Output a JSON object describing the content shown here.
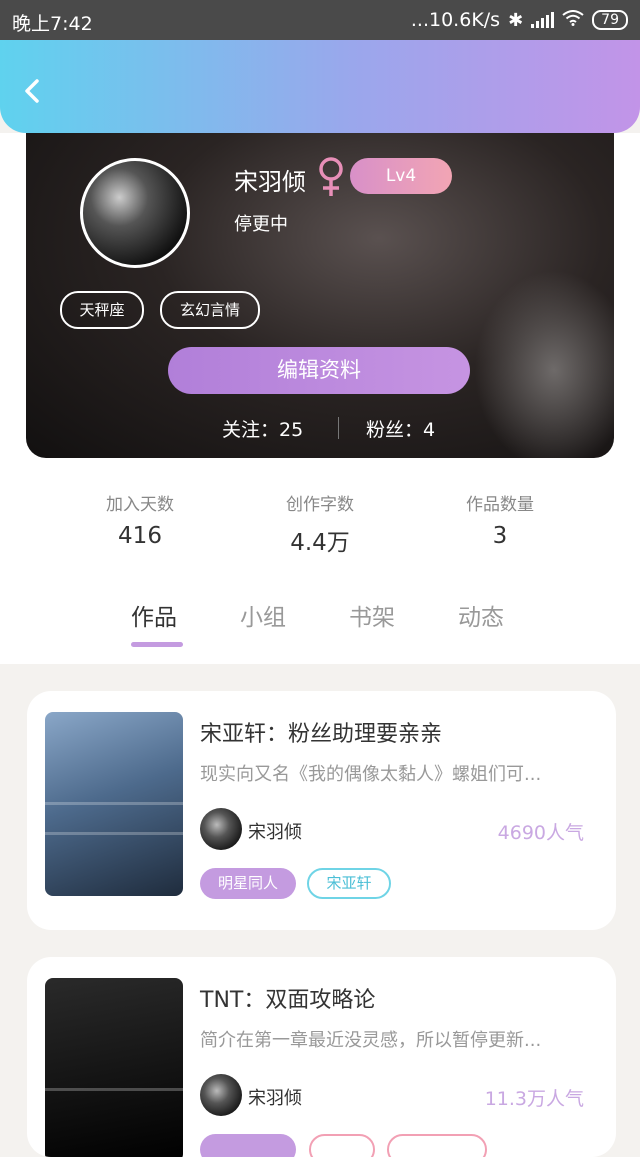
{
  "status_bar": {
    "time": "晚上7:42",
    "network_speed": "...10.6K/s",
    "battery": "79"
  },
  "header": {
    "back_icon": "chevron-left-icon"
  },
  "profile": {
    "name": "宋羽倾",
    "gender_icon": "female-icon",
    "level": "Lv4",
    "status": "停更中",
    "tags": [
      "天秤座",
      "玄幻言情"
    ],
    "edit_button": "编辑资料",
    "following": "关注：25",
    "followers": "粉丝：4"
  },
  "stats": [
    {
      "label": "加入天数",
      "value": "416"
    },
    {
      "label": "创作字数",
      "value": "4.4万"
    },
    {
      "label": "作品数量",
      "value": "3"
    }
  ],
  "tabs": [
    "作品",
    "小组",
    "书架",
    "动态"
  ],
  "active_tab": "作品",
  "works": [
    {
      "title": "宋亚轩：粉丝助理要亲亲",
      "description": "现实向又名《我的偶像太黏人》螺姐们可...",
      "author": "宋羽倾",
      "popularity": "4690人气",
      "tags": [
        "明星同人",
        "宋亚轩"
      ]
    },
    {
      "title": "TNT：双面攻略论",
      "description": "简介在第一章最近没灵感，所以暂停更新...",
      "author": "宋羽倾",
      "popularity": "11.3万人气"
    }
  ],
  "colors": {
    "header_gradient_start": "#5fd2ee",
    "header_gradient_end": "#c294e8",
    "accent_purple": "#c49be0",
    "tag_cyan": "#6fd4e6"
  }
}
